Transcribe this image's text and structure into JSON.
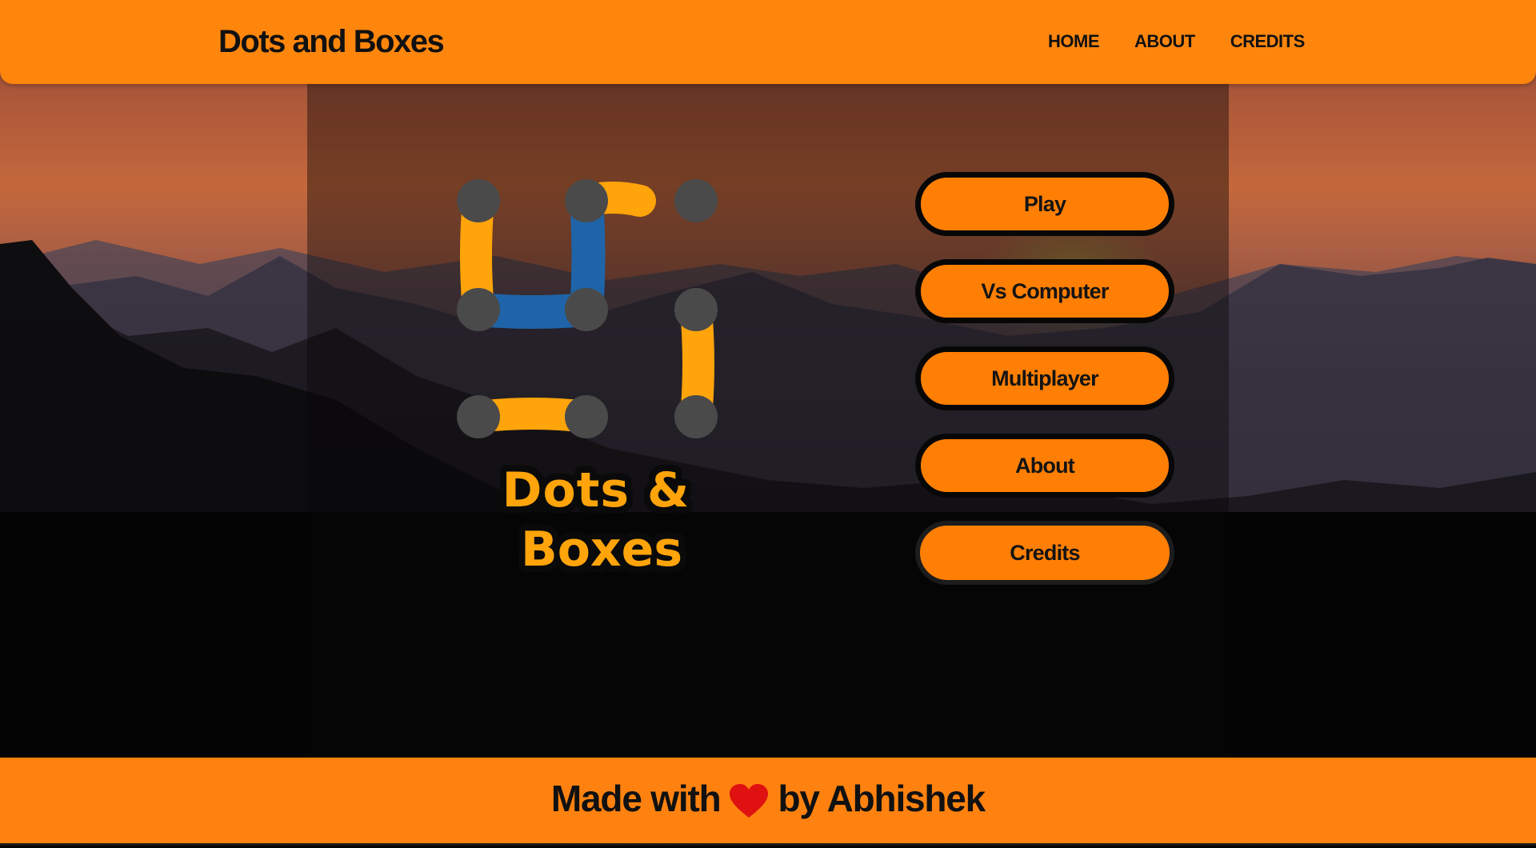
{
  "header": {
    "brand": "Dots and Boxes",
    "nav": [
      {
        "label": "HOME"
      },
      {
        "label": "ABOUT"
      },
      {
        "label": "CREDITS"
      }
    ]
  },
  "logo": {
    "icon": "dots-and-boxes-logo-icon",
    "colors": {
      "dot": "#4a4a4a",
      "line_orange": "#ffa40a",
      "line_blue": "#1f64a8"
    }
  },
  "title": {
    "line1": "Dots &",
    "line2": "Boxes"
  },
  "menu": {
    "play": "Play",
    "vs_computer": "Vs Computer",
    "multiplayer": "Multiplayer",
    "about": "About",
    "credits": "Credits"
  },
  "footer": {
    "prefix": "Made with",
    "heart_icon": "heart-icon",
    "suffix": "by Abhishek"
  },
  "colors": {
    "accent": "#ff860d",
    "button": "#ff7f04",
    "title_text": "#ffa40a",
    "heart": "#e01111"
  }
}
